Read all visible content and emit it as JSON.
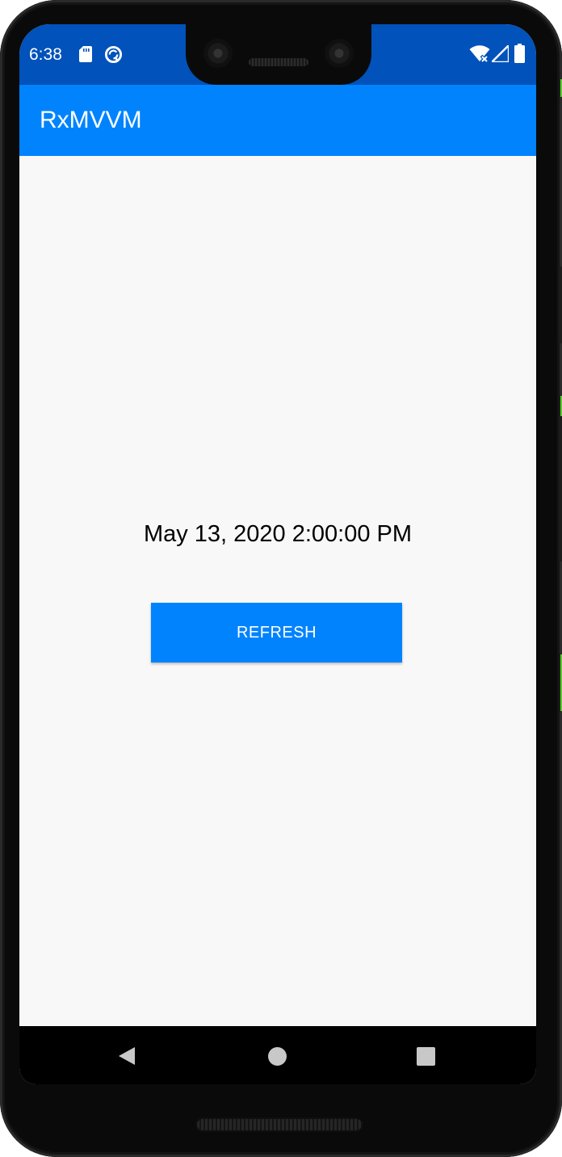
{
  "status_bar": {
    "time": "6:38",
    "icons": [
      "sd-card-icon",
      "sync-icon",
      "wifi-off-icon",
      "signal-icon",
      "battery-icon"
    ]
  },
  "app_bar": {
    "title": "RxMVVM"
  },
  "main": {
    "date_text": "May 13, 2020 2:00:00 PM",
    "refresh_label": "REFRESH"
  },
  "nav_bar": {
    "icons": [
      "back-icon",
      "home-icon",
      "recents-icon"
    ]
  },
  "colors": {
    "status_bar": "#0152ba",
    "app_bar": "#0183fe",
    "button": "#0183fe",
    "background": "#f8f8f8"
  }
}
